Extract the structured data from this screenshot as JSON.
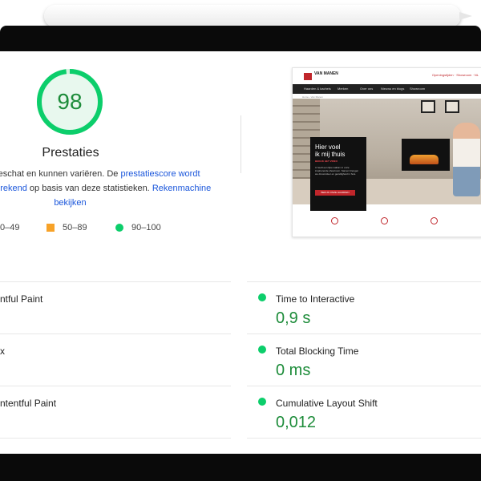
{
  "gauge": {
    "score": "98",
    "title": "Prestaties"
  },
  "description": {
    "line1_text": " geschat en kunnen variëren. De ",
    "line1_link": "prestatiescore wordt",
    "line2_link": "berekend",
    "line2_text": " op basis van deze statistieken. ",
    "line2_link2": "Rekenmachine",
    "line3_link": "bekijken"
  },
  "legend": {
    "fail": "0–49",
    "average": "50–89",
    "pass": "90–100"
  },
  "preview": {
    "brand": "VAN MANEN",
    "top_right": "Openingstijden · Showroom · NL",
    "nav": [
      "Haarden & kachels",
      "Merken",
      "Over ons",
      "Nieuws en blogs",
      "Showroom"
    ],
    "crumb": "Home › Van Manen",
    "hero_title_1": "Hier voel",
    "hero_title_2": "ik mij thuis",
    "hero_sub": "BEKIJK HET VIDEO",
    "hero_para": "U heeft een fijne wallum in onze inspirerende showroom. Samen brengen we droomsfeer en gezelligheid in huis.",
    "hero_button": "BEKIJK ONZE HAARDEN"
  },
  "metrics_left": [
    {
      "label": "ntful Paint"
    },
    {
      "label": "x"
    },
    {
      "label": "ntentful Paint"
    }
  ],
  "metrics_right": [
    {
      "label": "Time to Interactive",
      "value": "0,9 s"
    },
    {
      "label": "Total Blocking Time",
      "value": "0 ms"
    },
    {
      "label": "Cumulative Layout Shift",
      "value": "0,012"
    }
  ],
  "colors": {
    "pass": "#0cce6b",
    "average": "#f7a228",
    "score_text": "#1d8c3a",
    "link": "#1a56db"
  }
}
